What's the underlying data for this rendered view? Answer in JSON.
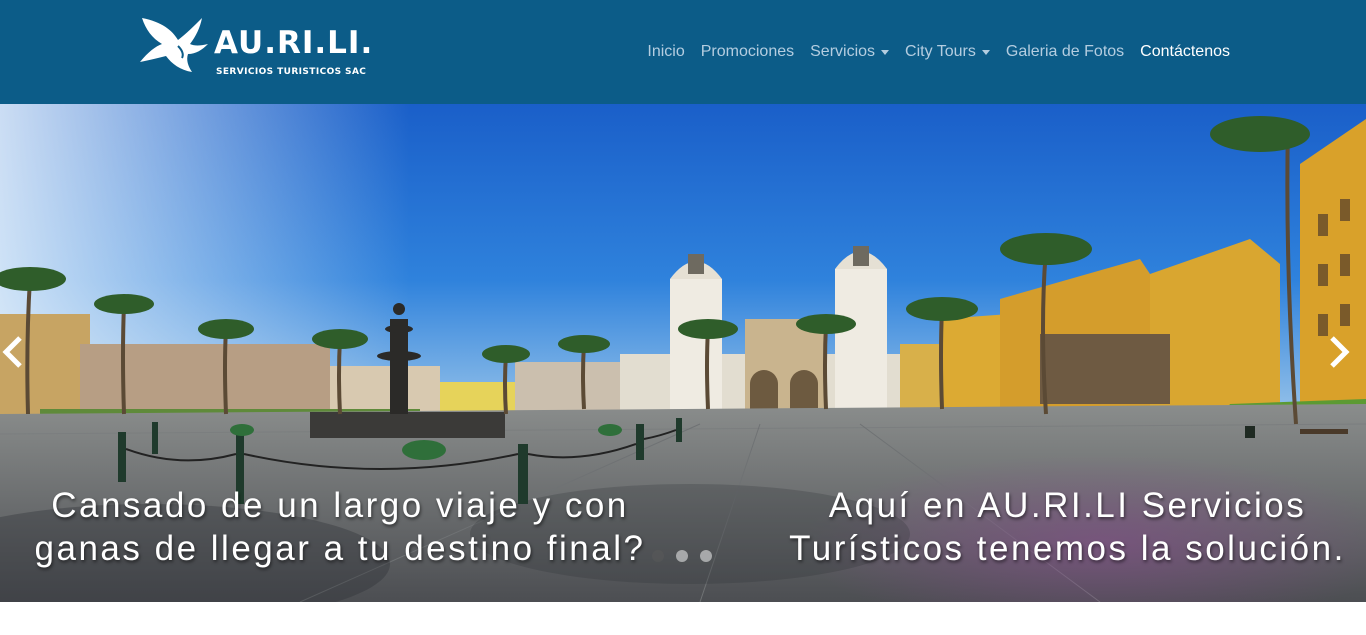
{
  "header": {
    "logo": {
      "name": "AU.RI.LI.",
      "subtitle": "SERVICIOS TURISTICOS SAC"
    },
    "nav": [
      {
        "label": "Inicio",
        "dropdown": false
      },
      {
        "label": "Promociones",
        "dropdown": false
      },
      {
        "label": "Servicios",
        "dropdown": true
      },
      {
        "label": "City Tours",
        "dropdown": true
      },
      {
        "label": "Galeria de Fotos",
        "dropdown": false
      },
      {
        "label": "Contáctenos",
        "dropdown": false,
        "active": true
      }
    ]
  },
  "carousel": {
    "caption_left": "Cansado de un largo viaje y con ganas de llegar a tu destino final?",
    "caption_right": "Aquí en AU.RI.LI Servicios Turísticos tenemos la solución.",
    "slide_count": 3,
    "active_slide": 1
  },
  "colors": {
    "navbar": "#0c5c88",
    "nav_text": "#b4cde0",
    "nav_active": "#ffffff",
    "sky": "#1f6fd0",
    "buildings_yellow": "#d9a22c",
    "cathedral": "#e8e3d6",
    "plaza": "#6b6f72"
  }
}
